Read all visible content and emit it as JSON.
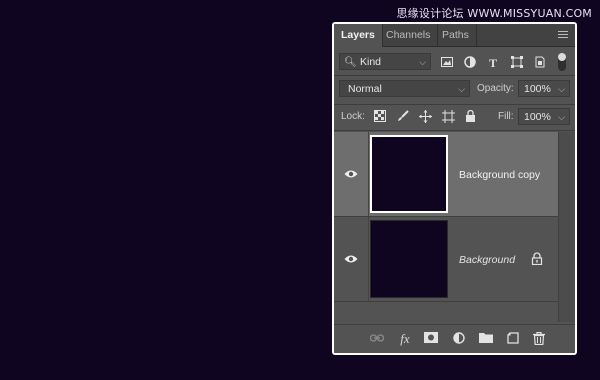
{
  "watermark": "思缘设计论坛 WWW.MISSYUAN.COM",
  "tabs": [
    "Layers",
    "Channels",
    "Paths"
  ],
  "filter": {
    "label": "Kind"
  },
  "blend": {
    "mode": "Normal"
  },
  "opacity": {
    "label": "Opacity:",
    "value": "100%"
  },
  "lock": {
    "label": "Lock:"
  },
  "fill": {
    "label": "Fill:",
    "value": "100%"
  },
  "layers": [
    {
      "name": "Background copy",
      "selected": true,
      "visible": true
    },
    {
      "name": "Background",
      "selected": false,
      "visible": true,
      "locked": true
    }
  ],
  "colors": {
    "canvas": "#0f0520",
    "panel": "#535353",
    "selected_layer": "#6e6e6e"
  },
  "icons": {
    "filter": "search-icon",
    "kind_filters": [
      "image-icon",
      "adjustment-icon",
      "type-icon",
      "shape-icon",
      "smart-object-icon"
    ],
    "lock": [
      "lock-transparent-icon",
      "lock-paint-icon",
      "lock-move-icon",
      "lock-artboard-icon",
      "lock-all-icon"
    ],
    "bottom": [
      "link-icon",
      "fx-icon",
      "mask-icon",
      "adjustment-layer-icon",
      "group-icon",
      "new-layer-icon",
      "trash-icon"
    ]
  }
}
